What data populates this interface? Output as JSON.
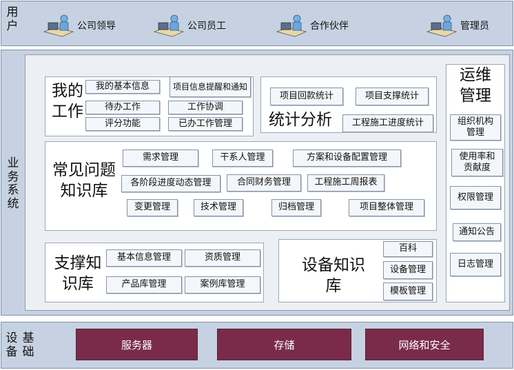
{
  "bands": {
    "users": {
      "label_line1": "用",
      "label_line2": "户"
    },
    "business": {
      "label": "业务系统"
    },
    "infra": {
      "label_col1": "设备",
      "label_col2": "基础"
    }
  },
  "users": [
    {
      "label": "公司领导",
      "icon": "user-computer-icon"
    },
    {
      "label": "公司员工",
      "icon": "user-computer-icon"
    },
    {
      "label": "合作伙伴",
      "icon": "user-computer-icon"
    },
    {
      "label": "管理员",
      "icon": "user-computer-icon"
    }
  ],
  "my_work": {
    "title_line1": "我的",
    "title_line2": "工作",
    "items": [
      "我的基本信息",
      "项目信息提醒和通知",
      "待办工作",
      "工作协调",
      "评分功能",
      "已办工作管理"
    ]
  },
  "stats": {
    "title": "统计分析",
    "items": [
      "项目回款统计",
      "项目支撑统计",
      "工程施工进度统计"
    ]
  },
  "faq": {
    "title_line1": "常见问题",
    "title_line2": "知识库",
    "items": [
      "需求管理",
      "干系人管理",
      "方案和设备配置管理",
      "各阶段进度动态管理",
      "合同财务管理",
      "工程施工周报表",
      "变更管理",
      "技术管理",
      "归档管理",
      "项目整体管理"
    ]
  },
  "support": {
    "title_line1": "支撑知",
    "title_line2": "识库",
    "items": [
      "基本信息管理",
      "资质管理",
      "产品库管理",
      "案例库管理"
    ]
  },
  "equipment": {
    "title_line1": "设备知识",
    "title_line2": "库",
    "items": [
      "百科",
      "设备管理",
      "模板管理"
    ]
  },
  "ops": {
    "title_line1": "运维",
    "title_line2": "管理",
    "items": [
      "组织机构管理",
      "使用率和贡献度",
      "权限管理",
      "通知公告",
      "日志管理"
    ]
  },
  "infra_items": [
    "服务器",
    "存储",
    "网络和安全"
  ],
  "colors": {
    "band": "#c6d2e2",
    "infra": "#7a2b4a",
    "panel": "#eceff3"
  }
}
